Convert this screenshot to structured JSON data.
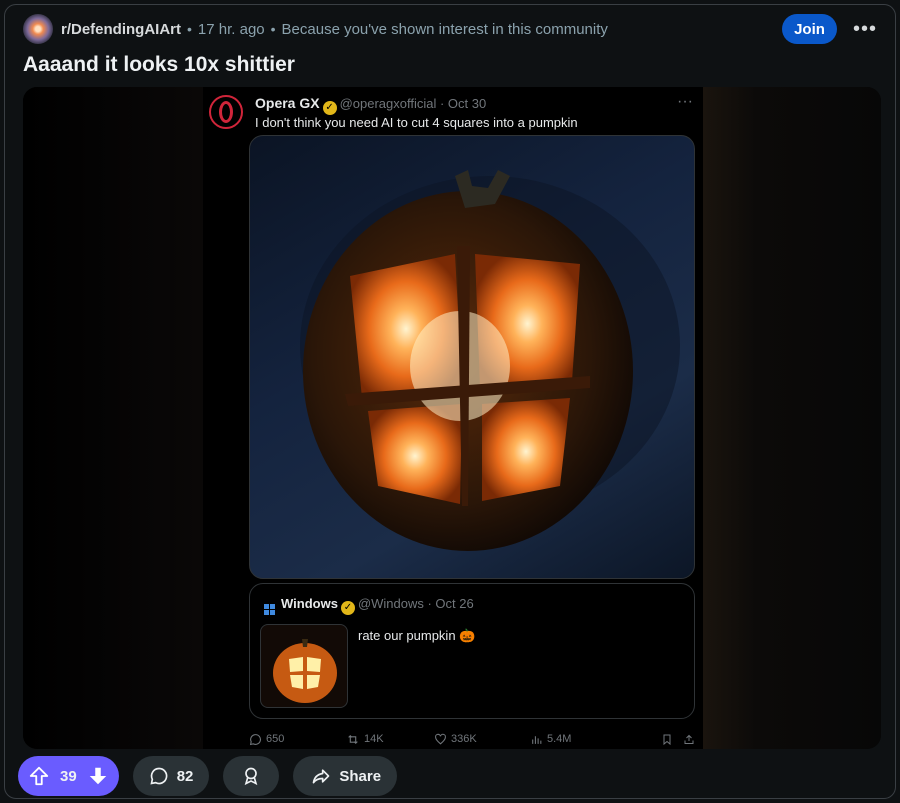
{
  "post": {
    "subreddit": "r/DefendingAIArt",
    "age": "17 hr. ago",
    "reason": "Because you've shown interest in this community",
    "join_label": "Join",
    "more_label": "•••",
    "title": "Aaaand it looks 10x shittier"
  },
  "tweet": {
    "name": "Opera GX",
    "handle": "@operagxofficial · Oct 30",
    "text": "I don't think you need AI to cut 4 squares into a pumpkin",
    "more": "···",
    "quote": {
      "name": "Windows",
      "handle": "@Windows · Oct 26",
      "text": "rate our pumpkin 🎃"
    },
    "stats": {
      "replies": "650",
      "reposts": "14K",
      "likes": "336K",
      "views": "5.4M"
    }
  },
  "actions": {
    "votes": "39",
    "comments": "82",
    "share_label": "Share"
  },
  "colors": {
    "accent_join": "#0a58ca",
    "vote_pill": "#6a5cff",
    "verified_badge": "#e2b719",
    "opera_red": "#d0253a"
  }
}
